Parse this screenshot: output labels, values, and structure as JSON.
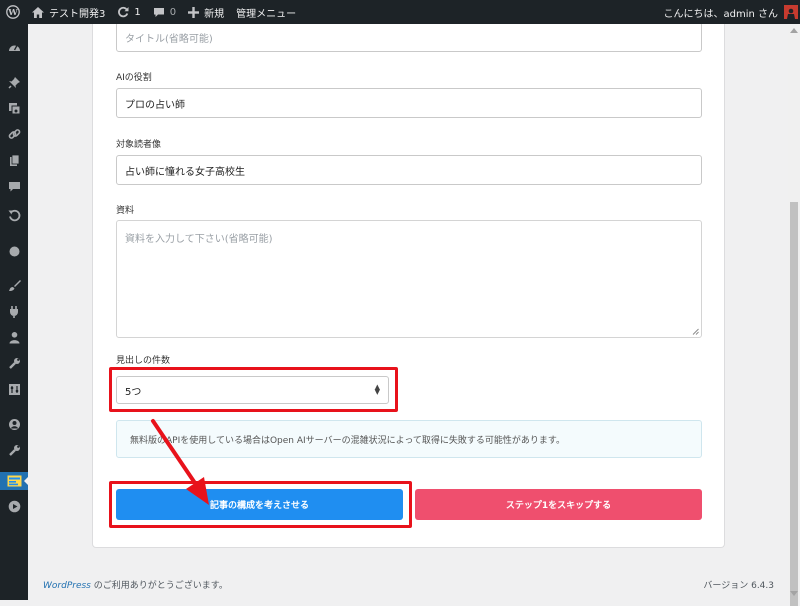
{
  "adminbar": {
    "site_name": "テスト開発3",
    "updates_count": "1",
    "comments_count": "0",
    "new_label": "新規",
    "admin_menu_label": "管理メニュー",
    "greeting": "こんにちは、admin さん"
  },
  "form": {
    "title_placeholder": "タイトル(省略可能)",
    "role_label": "AIの役割",
    "role_value": "プロの占い師",
    "audience_label": "対象読者像",
    "audience_value": "占い師に憧れる女子高校生",
    "material_label": "資料",
    "material_placeholder": "資料を入力して下さい(省略可能)",
    "heading_count_label": "見出しの件数",
    "heading_count_value": "5つ",
    "notice": "無料版のAPIを使用している場合はOpen AIサーバーの混雑状況によって取得に失敗する可能性があります。",
    "generate_button": "記事の構成を考えさせる",
    "skip_button": "ステップ1をスキップする"
  },
  "footer": {
    "wordpress_link": "WordPress",
    "thanks": " のご利用ありがとうございます。",
    "version": "バージョン 6.4.3"
  },
  "colors": {
    "admin_bar": "#1d2327",
    "primary_button": "#1f8ef1",
    "danger_button": "#ef4f6e",
    "highlight": "#e8121b",
    "active_menu": "#2271b1"
  },
  "annotations": {
    "highlight_boxes": [
      "heading-count-select",
      "generate-structure-button"
    ],
    "arrow": "red arrow pointing from select to button"
  }
}
